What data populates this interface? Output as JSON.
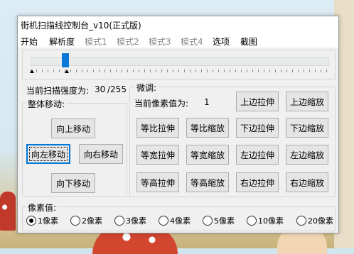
{
  "window": {
    "title": "街机扫描线控制台_v10(正式版)"
  },
  "menu": {
    "items": [
      {
        "label": "开始",
        "enabled": true
      },
      {
        "label": "解析度",
        "enabled": true
      },
      {
        "label": "模式1",
        "enabled": false
      },
      {
        "label": "模式2",
        "enabled": false
      },
      {
        "label": "模式3",
        "enabled": false
      },
      {
        "label": "模式4",
        "enabled": false
      },
      {
        "label": "选项",
        "enabled": true
      },
      {
        "label": "截图",
        "enabled": true
      }
    ]
  },
  "scan": {
    "intensity_label": "当前扫描强度为:",
    "intensity_value": "30",
    "intensity_max": "/255",
    "slider_fraction": 0.118
  },
  "move": {
    "title": "整体移动:",
    "up": "向上移动",
    "left": "向左移动",
    "right": "向右移动",
    "down": "向下移动"
  },
  "tune": {
    "title": "微调:",
    "pixel_label": "当前像素值为:",
    "pixel_value": "1",
    "buttons": {
      "top_stretch": "上边拉伸",
      "top_shrink": "上边缩放",
      "ratio_stretch": "等比拉伸",
      "ratio_shrink": "等比缩放",
      "bottom_stretch": "下边拉伸",
      "bottom_shrink": "下边缩放",
      "width_stretch": "等宽拉伸",
      "width_shrink": "等宽缩放",
      "left_stretch": "左边拉伸",
      "left_shrink": "左边缩放",
      "height_stretch": "等高拉伸",
      "height_shrink": "等高缩放",
      "right_stretch": "右边拉伸",
      "right_shrink": "右边缩放"
    }
  },
  "pixels": {
    "title": "像素值:",
    "options": [
      "1像素",
      "2像素",
      "3像素",
      "4像素",
      "5像素",
      "10像素",
      "20像素"
    ],
    "selected": "1像素"
  },
  "colors": {
    "accent": "#0078d7",
    "slider_thumb": "#0a78d7",
    "disabled_text": "#8a8a8a"
  }
}
